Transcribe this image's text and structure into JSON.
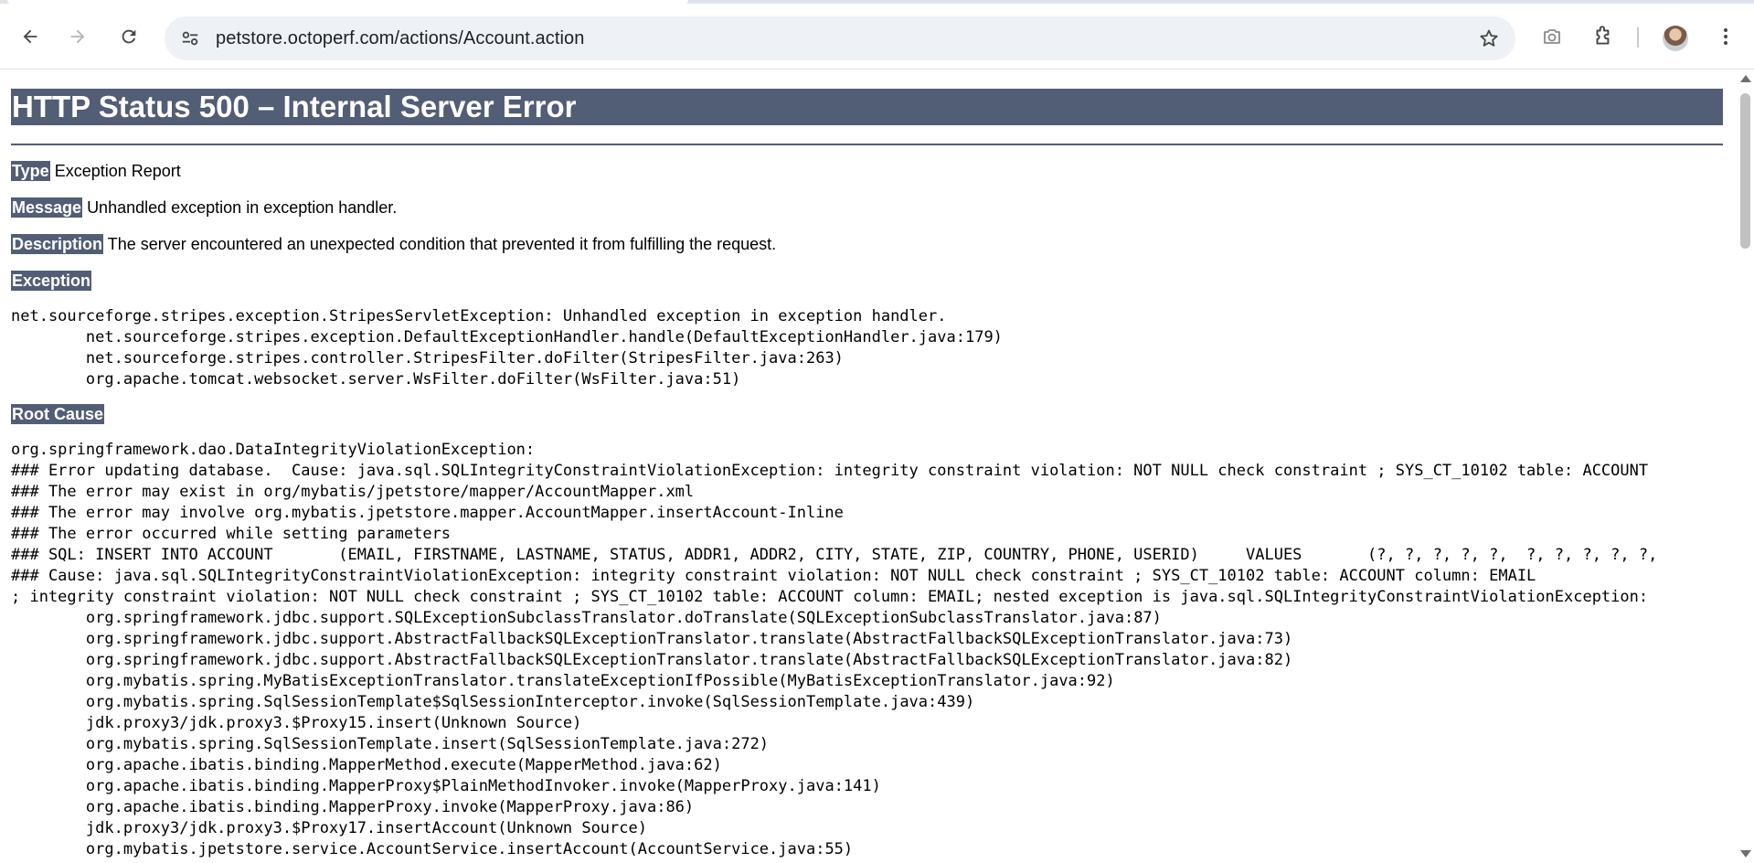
{
  "browser": {
    "url": "petstore.octoperf.com/actions/Account.action",
    "icons": {
      "back": "arrow-left-icon",
      "forward": "arrow-right-icon",
      "reload": "reload-icon",
      "site_info": "tune-icon",
      "bookmark": "star-icon",
      "screenshot": "camera-icon",
      "extensions": "puzzle-icon",
      "menu": "kebab-menu-icon"
    }
  },
  "page": {
    "title": "HTTP Status 500 – Internal Server Error",
    "type_label": "Type",
    "type_value": "Exception Report",
    "message_label": "Message",
    "message_value": "Unhandled exception in exception handler.",
    "description_label": "Description",
    "description_value": "The server encountered an unexpected condition that prevented it from fulfilling the request.",
    "exception_label": "Exception",
    "exception_trace": [
      "net.sourceforge.stripes.exception.StripesServletException: Unhandled exception in exception handler.",
      "\tnet.sourceforge.stripes.exception.DefaultExceptionHandler.handle(DefaultExceptionHandler.java:179)",
      "\tnet.sourceforge.stripes.controller.StripesFilter.doFilter(StripesFilter.java:263)",
      "\torg.apache.tomcat.websocket.server.WsFilter.doFilter(WsFilter.java:51)"
    ],
    "root_cause_label": "Root Cause",
    "root_cause_trace": [
      "org.springframework.dao.DataIntegrityViolationException: ",
      "### Error updating database.  Cause: java.sql.SQLIntegrityConstraintViolationException: integrity constraint violation: NOT NULL check constraint ; SYS_CT_10102 table: ACCOUNT",
      "### The error may exist in org/mybatis/jpetstore/mapper/AccountMapper.xml",
      "### The error may involve org.mybatis.jpetstore.mapper.AccountMapper.insertAccount-Inline",
      "### The error occurred while setting parameters",
      "### SQL: INSERT INTO ACCOUNT       (EMAIL, FIRSTNAME, LASTNAME, STATUS, ADDR1, ADDR2, CITY, STATE, ZIP, COUNTRY, PHONE, USERID)     VALUES       (?, ?, ?, ?, ?,  ?, ?, ?, ?, ?,",
      "### Cause: java.sql.SQLIntegrityConstraintViolationException: integrity constraint violation: NOT NULL check constraint ; SYS_CT_10102 table: ACCOUNT column: EMAIL",
      "; integrity constraint violation: NOT NULL check constraint ; SYS_CT_10102 table: ACCOUNT column: EMAIL; nested exception is java.sql.SQLIntegrityConstraintViolationException:",
      "\torg.springframework.jdbc.support.SQLExceptionSubclassTranslator.doTranslate(SQLExceptionSubclassTranslator.java:87)",
      "\torg.springframework.jdbc.support.AbstractFallbackSQLExceptionTranslator.translate(AbstractFallbackSQLExceptionTranslator.java:73)",
      "\torg.springframework.jdbc.support.AbstractFallbackSQLExceptionTranslator.translate(AbstractFallbackSQLExceptionTranslator.java:82)",
      "\torg.mybatis.spring.MyBatisExceptionTranslator.translateExceptionIfPossible(MyBatisExceptionTranslator.java:92)",
      "\torg.mybatis.spring.SqlSessionTemplate$SqlSessionInterceptor.invoke(SqlSessionTemplate.java:439)",
      "\tjdk.proxy3/jdk.proxy3.$Proxy15.insert(Unknown Source)",
      "\torg.mybatis.spring.SqlSessionTemplate.insert(SqlSessionTemplate.java:272)",
      "\torg.apache.ibatis.binding.MapperMethod.execute(MapperMethod.java:62)",
      "\torg.apache.ibatis.binding.MapperProxy$PlainMethodInvoker.invoke(MapperProxy.java:141)",
      "\torg.apache.ibatis.binding.MapperProxy.invoke(MapperProxy.java:86)",
      "\tjdk.proxy3/jdk.proxy3.$Proxy17.insertAccount(Unknown Source)",
      "\torg.mybatis.jpetstore.service.AccountService.insertAccount(AccountService.java:55)"
    ]
  },
  "colors": {
    "header_bg": "#525d76",
    "header_text": "#ffffff",
    "omnibox_bg": "#eef1f5"
  }
}
